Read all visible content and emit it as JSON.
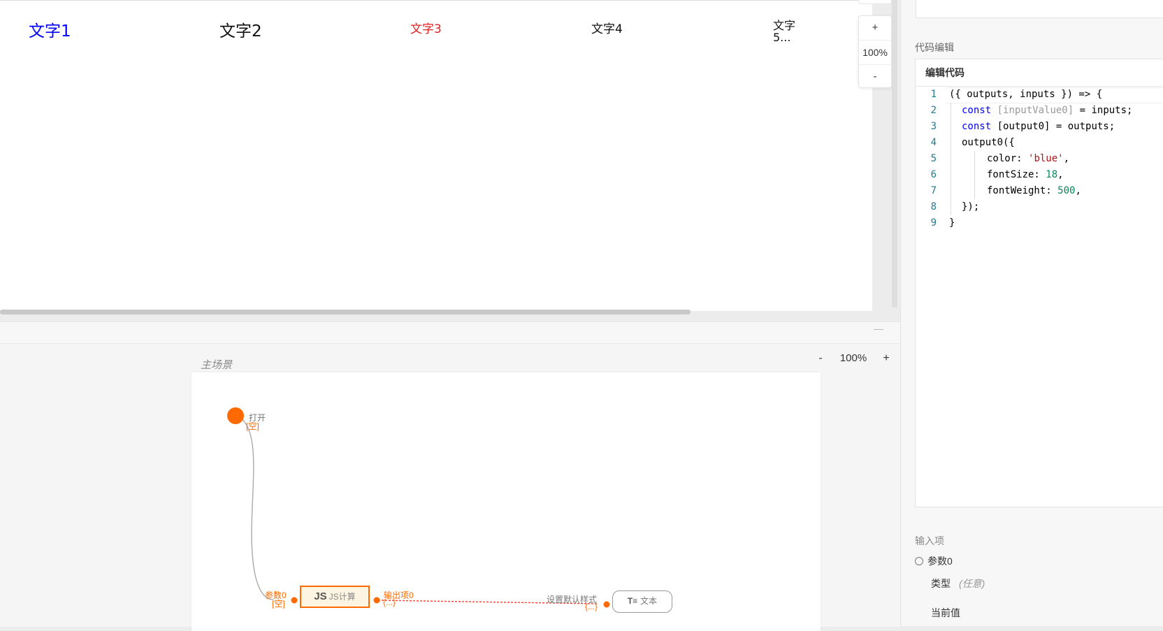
{
  "canvas": {
    "texts": [
      "文字1",
      "文字2",
      "文字3",
      "文字4",
      "文字5..."
    ],
    "zoom": {
      "plus": "+",
      "value": "100%",
      "minus": "-"
    }
  },
  "logic": {
    "scene_title": "主场景",
    "zoom": {
      "minus": "-",
      "value": "100%",
      "plus": "+"
    },
    "nodes": {
      "open": {
        "label": "打开",
        "value": "[空]"
      },
      "js": {
        "icon": "JS",
        "label": "JS计算"
      },
      "js_input": {
        "label": "参数0",
        "value": "[空]"
      },
      "js_output": {
        "label": "输出项0",
        "value": "{...}"
      },
      "target_input": {
        "label": "设置默认样式",
        "value": "{...}"
      },
      "text": {
        "icon": "text-icon",
        "label": "文本"
      }
    },
    "colors": {
      "accent": "#ff6a00",
      "wire": "#aaaaaa",
      "dashed": "#ff3b30"
    }
  },
  "panel": {
    "code_section": "代码编辑",
    "code_header": "编辑代码",
    "line_numbers": [
      "1",
      "2",
      "3",
      "4",
      "5",
      "6",
      "7",
      "8",
      "9"
    ],
    "code": {
      "l1": "({ outputs, inputs }) => {",
      "l2_kw": "const",
      "l2_arr": "[inputValue0]",
      "l2_rest": " = inputs;",
      "l3_kw": "const",
      "l3_rest": " [output0] = outputs;",
      "l4": "output0({",
      "l5_key": "color: ",
      "l5_val": "'blue'",
      "l6_key": "fontSize: ",
      "l6_val": "18",
      "l7_key": "fontWeight: ",
      "l7_val": "500",
      "l8": "});",
      "l9": "}"
    },
    "inputs_section": "输入项",
    "param": "参数0",
    "type_label": "类型",
    "type_value": "(任意)",
    "current_value_label": "当前值"
  }
}
